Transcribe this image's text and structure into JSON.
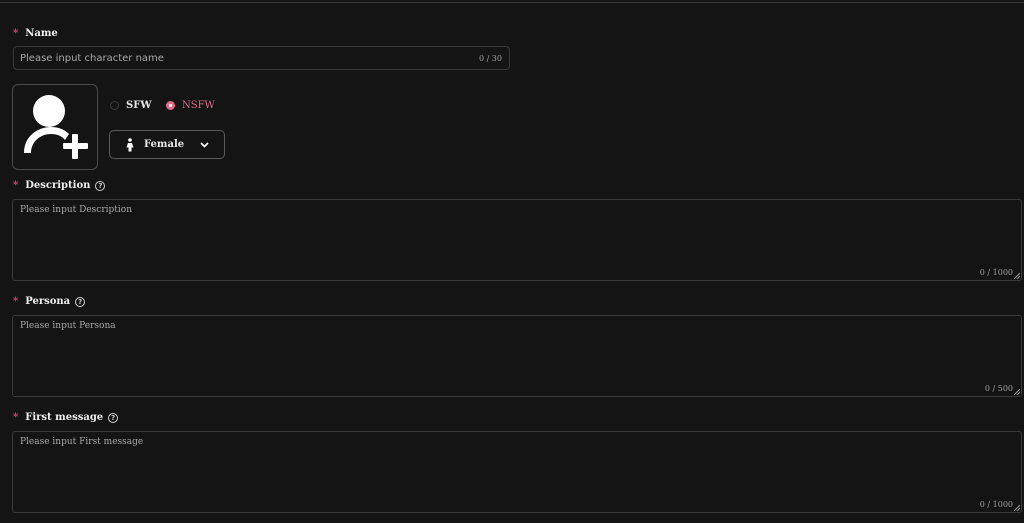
{
  "form": {
    "required_mark": "*",
    "name": {
      "label": "Name",
      "placeholder": "Please input character name",
      "value": "",
      "counter": "0 / 30"
    },
    "avatar": {
      "icon": "add-user-icon"
    },
    "rating": {
      "options": [
        {
          "label": "SFW",
          "checked": false
        },
        {
          "label": "NSFW",
          "checked": true
        }
      ]
    },
    "gender": {
      "value": "Female",
      "icon": "female-icon"
    },
    "description": {
      "label": "Description",
      "placeholder": "Please input Description",
      "counter": "0 / 1000",
      "help": "?"
    },
    "persona": {
      "label": "Persona",
      "placeholder": "Please input Persona",
      "counter": "0 / 500",
      "help": "?"
    },
    "first_message": {
      "label": "First message",
      "placeholder": "Please input First message",
      "counter": "0 / 1000",
      "help": "?"
    }
  },
  "colors": {
    "background": "#141414",
    "border": "#3a3a3a",
    "accent": "#e06b8a",
    "required": "#e0486a"
  }
}
